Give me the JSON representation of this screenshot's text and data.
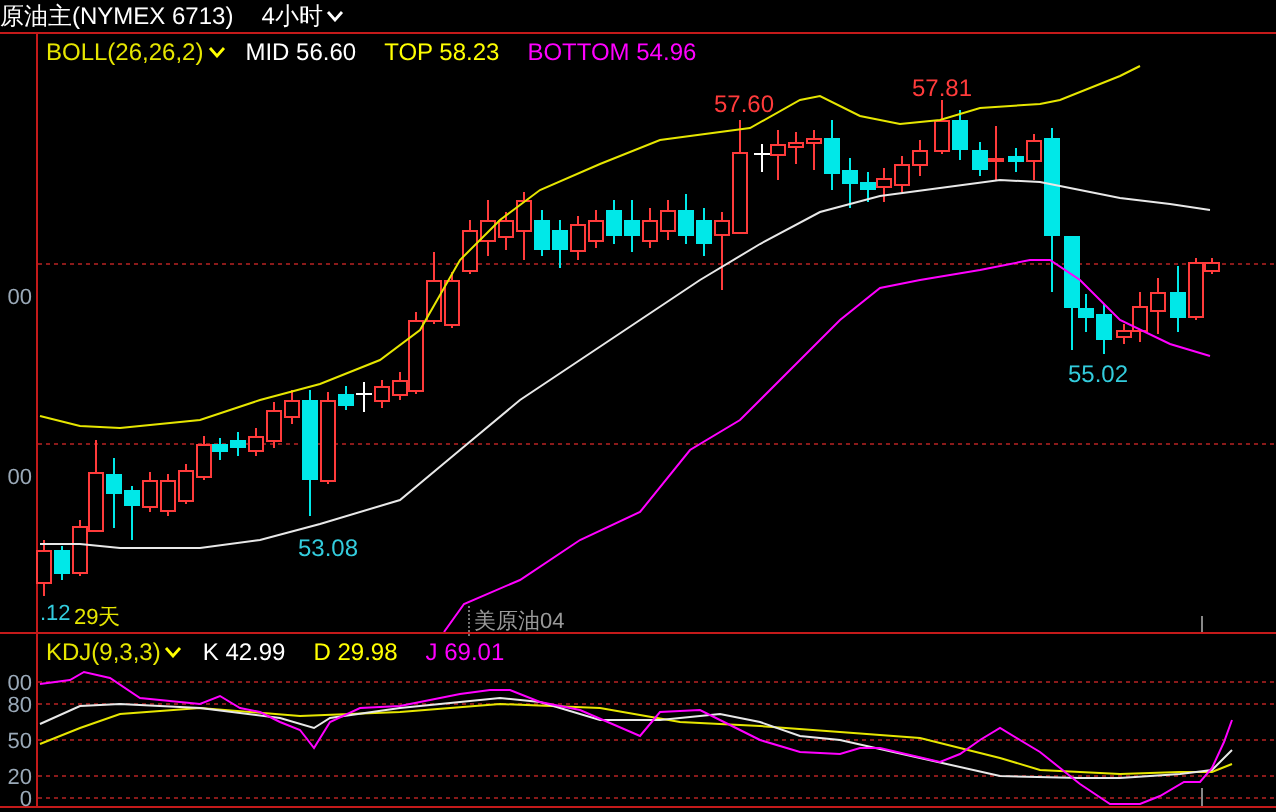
{
  "header": {
    "title": "原油主(NYMEX 6713)",
    "timeframe": "4小时"
  },
  "main_panel": {
    "indicator": "BOLL(26,26,2)",
    "legend": [
      {
        "label": "MID 56.60",
        "color": "#ffffff"
      },
      {
        "label": "TOP 58.23",
        "color": "#ffff00"
      },
      {
        "label": "BOTTOM 54.96",
        "color": "#ff00ff"
      }
    ],
    "y_axis_labels": [
      "00",
      "00"
    ],
    "price_labels": [
      {
        "text": "57.60",
        "color": "#ff3b3b"
      },
      {
        "text": "57.81",
        "color": "#ff3b3b"
      },
      {
        "text": "53.08",
        "color": "#33ccdd"
      },
      {
        "text": "55.02",
        "color": "#33ccdd"
      }
    ],
    "contract_label": "美原油04",
    "date_labels": [
      ".12",
      "29天"
    ]
  },
  "kdj_panel": {
    "indicator": "KDJ(9,3,3)",
    "legend": [
      {
        "label": "K 42.99",
        "color": "#ffffff"
      },
      {
        "label": "D 29.98",
        "color": "#ffff00"
      },
      {
        "label": "J 69.01",
        "color": "#ff00ff"
      }
    ],
    "y_axis_labels": [
      "00",
      "80",
      "50",
      "20",
      "0"
    ]
  }
}
